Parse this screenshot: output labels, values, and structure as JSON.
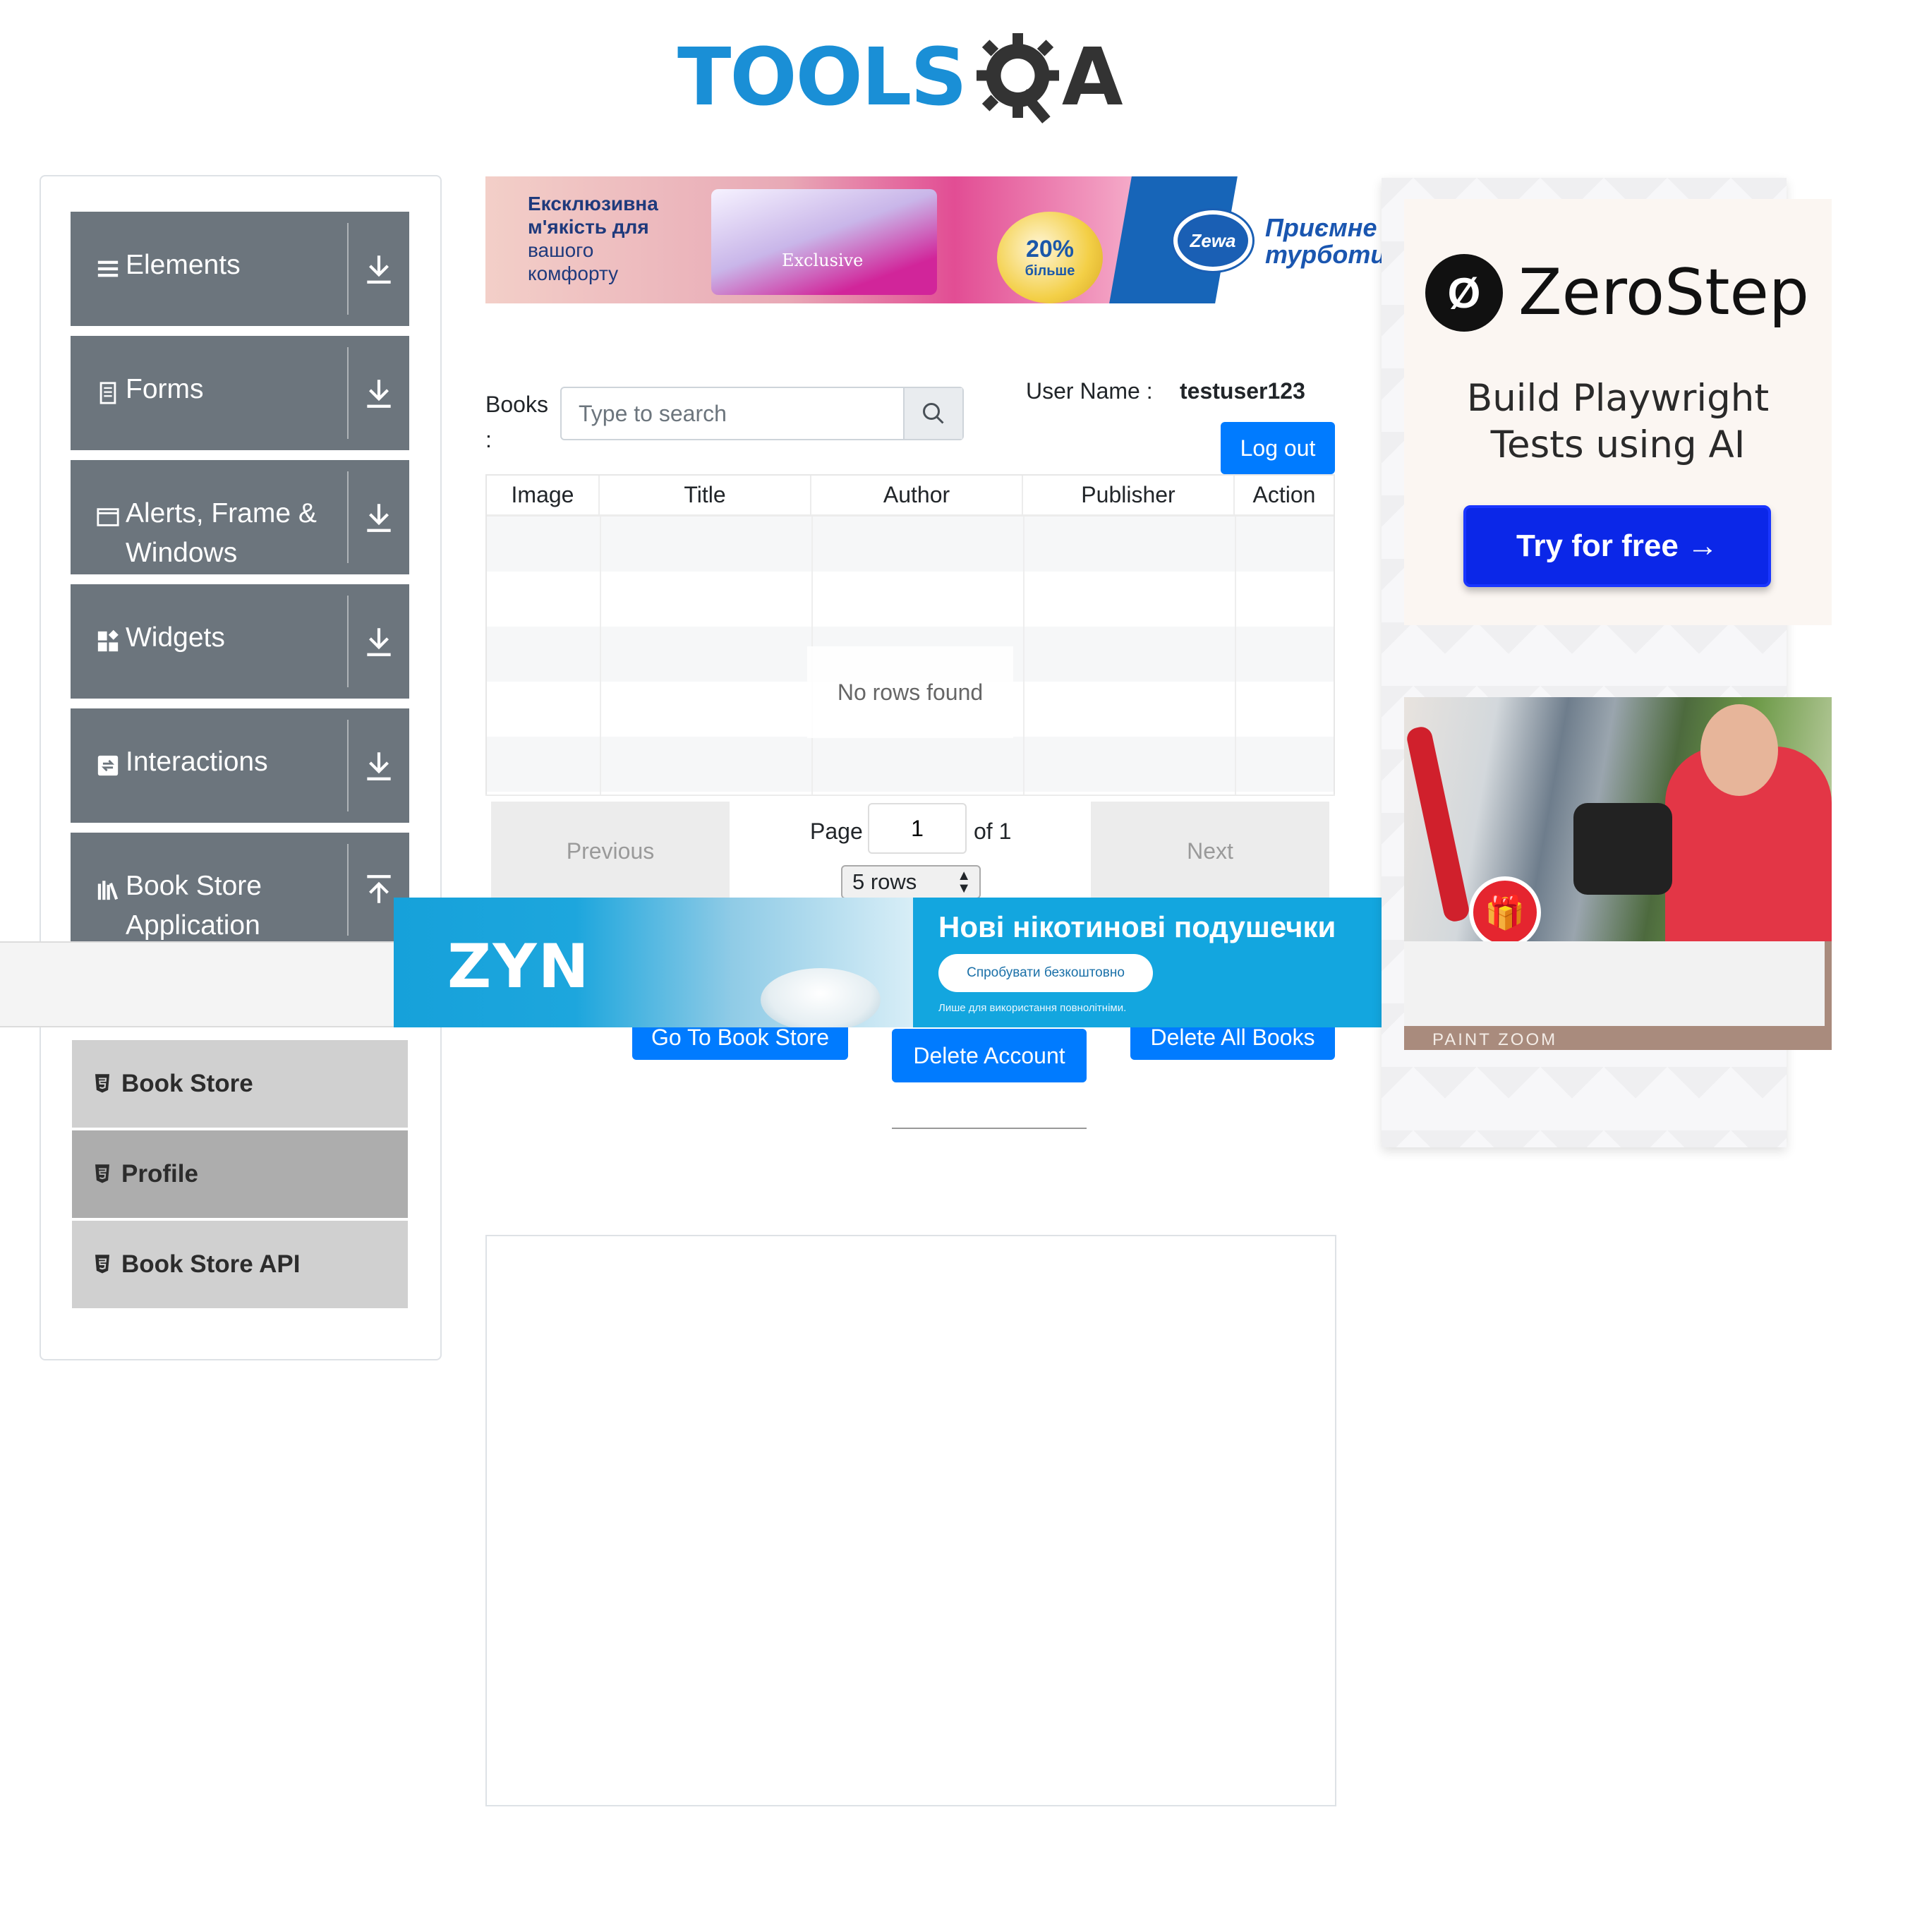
{
  "logo": {
    "tools": "TOOLS",
    "qa": "A"
  },
  "sidebar": {
    "groups": [
      {
        "label": "Elements",
        "icon": "menu-icon",
        "arrow": "download-arrow-icon"
      },
      {
        "label": "Forms",
        "icon": "document-icon",
        "arrow": "download-arrow-icon"
      },
      {
        "label": "Alerts, Frame & Windows",
        "icon": "window-icon",
        "arrow": "download-arrow-icon"
      },
      {
        "label": "Widgets",
        "icon": "widgets-icon",
        "arrow": "download-arrow-icon"
      },
      {
        "label": "Interactions",
        "icon": "interactions-icon",
        "arrow": "download-arrow-icon"
      },
      {
        "label": "Book Store Application",
        "icon": "books-icon",
        "arrow": "upload-arrow-icon"
      }
    ],
    "items": [
      {
        "label": "Book Store",
        "active": false
      },
      {
        "label": "Profile",
        "active": true
      },
      {
        "label": "Book Store API",
        "active": false
      }
    ]
  },
  "top_ad": {
    "text_line1": "Ексклюзивна",
    "text_line2": "м'якість для",
    "text_line3": "вашого",
    "text_line4": "комфорту",
    "pack_label": "Exclusive",
    "badge_big": "20%",
    "badge_small": "більше",
    "logo": "Zewa",
    "slogan_line1": "Приємне в",
    "slogan_line2": "турботи"
  },
  "profile": {
    "books_label": "Books :",
    "search_placeholder": "Type to search",
    "username_label": "User Name :",
    "username_value": "testuser123",
    "logout_label": "Log out"
  },
  "table": {
    "columns": [
      "Image",
      "Title",
      "Author",
      "Publisher",
      "Action"
    ],
    "no_rows": "No rows found"
  },
  "pagination": {
    "previous": "Previous",
    "next": "Next",
    "page_label": "Page",
    "page_value": "1",
    "of_label": "of 1",
    "rows_option": "5 rows"
  },
  "actions": {
    "go_to_store": "Go To Book Store",
    "delete_account": "Delete Account",
    "delete_all_books": "Delete All Books"
  },
  "zyn_ad": {
    "logo": "ZYN",
    "title": "Нові нікотинові подушечки",
    "cta": "Спробувати безкоштовно",
    "note": "Лише для використання повнолітніми."
  },
  "zerostep_ad": {
    "name": "ZeroStep",
    "tagline_line1": "Build Playwright",
    "tagline_line2": "Tests using AI",
    "cta": "Try for free →"
  },
  "paint_ad": {
    "brand": "PAINT ZOOM"
  },
  "colors": {
    "primary": "#007bff",
    "sidebar_group": "#6c757d",
    "logo_blue": "#1a8fd6"
  }
}
